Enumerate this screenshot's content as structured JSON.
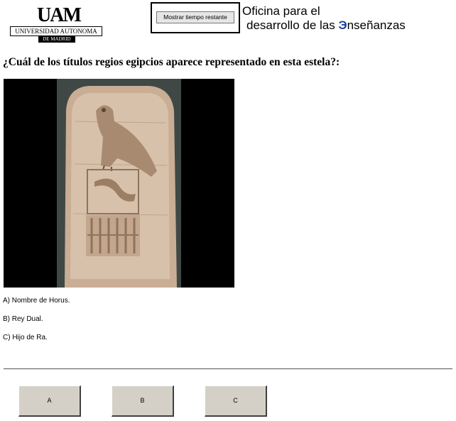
{
  "header": {
    "university_logo": {
      "mark": "UAM",
      "name": "UNIVERSIDAD AUTONOMA",
      "city": "DE MADRID"
    },
    "timer_button_label": "Mostrar tiempo restante",
    "office_logo": {
      "line1": "Oficina para el",
      "line2_prefix": "desarrollo de las ",
      "line2_mark": "Э",
      "line2_suffix": "nseñanzas",
      "mark_color": "#1f3f9f"
    }
  },
  "question": {
    "text": "¿Cuál de los títulos regios egipcios aparece representado en esta estela?:",
    "image": "stela-with-falcon-image"
  },
  "options": [
    {
      "text": "A) Nombre de Horus."
    },
    {
      "text": "B) Rey Dual."
    },
    {
      "text": "C) Hijo de Ra."
    }
  ],
  "answer_buttons": [
    {
      "label": "A"
    },
    {
      "label": "B"
    },
    {
      "label": "C"
    }
  ]
}
